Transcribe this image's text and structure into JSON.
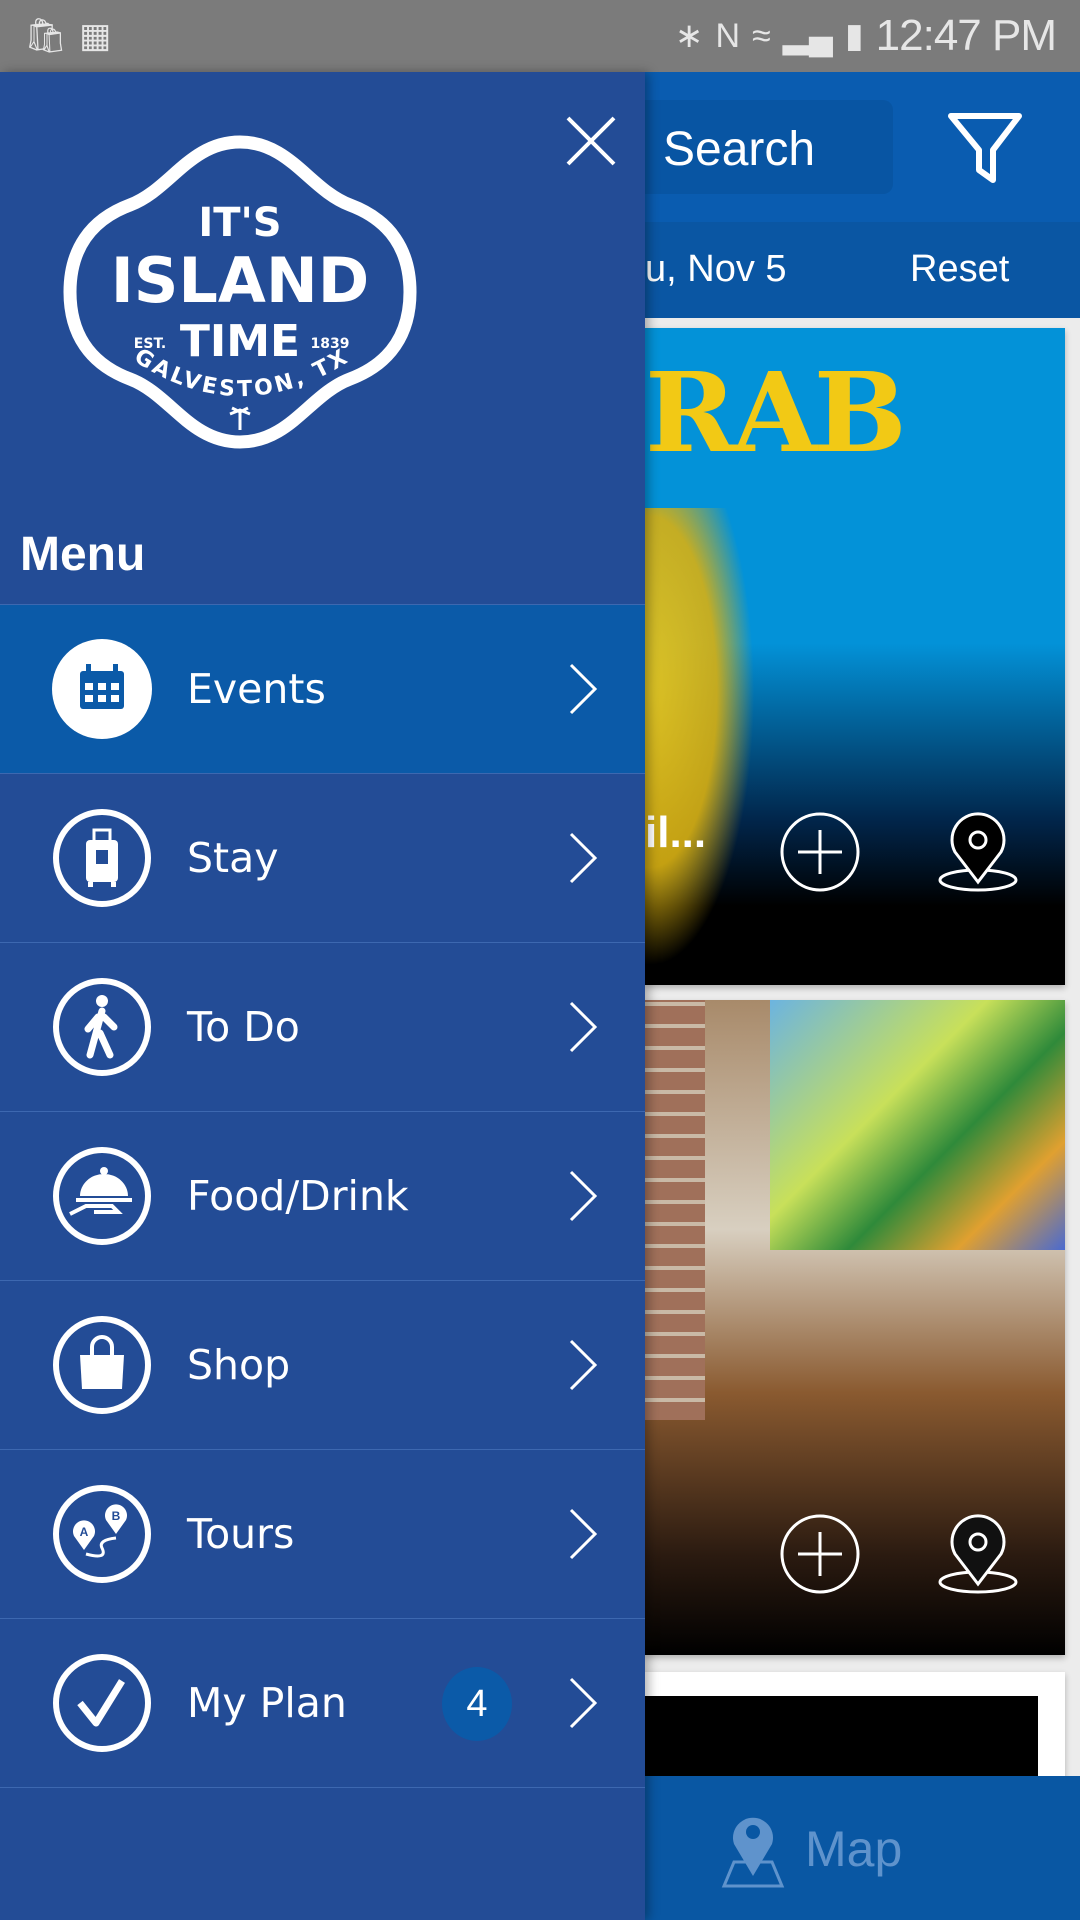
{
  "status_bar": {
    "time": "12:47 PM",
    "icons": [
      "shopping-bag-icon",
      "sim-off-icon",
      "bluetooth-icon",
      "nfc-icon",
      "wifi-icon",
      "signal-icon",
      "battery-charging-icon"
    ]
  },
  "header": {
    "search_label": "Search",
    "filter_icon": "filter-icon"
  },
  "date_bar": {
    "date": "u, Nov 5",
    "reset_label": "Reset"
  },
  "cards": [
    {
      "artwork_text": "RAB",
      "title": "il...",
      "add_icon": "plus-circle-icon",
      "map_icon": "map-pin-icon"
    },
    {
      "add_icon": "plus-circle-icon",
      "map_icon": "map-pin-icon"
    },
    {}
  ],
  "bottom_bar": {
    "map_label": "Map"
  },
  "drawer": {
    "logo": {
      "line1": "IT'S",
      "line2": "ISLAND",
      "line3": "TIME",
      "est": "EST.",
      "year": "1839",
      "place": "GALVESTON, TX"
    },
    "menu_title": "Menu",
    "items": [
      {
        "label": "Events",
        "icon": "calendar-icon",
        "active": true
      },
      {
        "label": "Stay",
        "icon": "luggage-icon"
      },
      {
        "label": "To Do",
        "icon": "walking-person-icon"
      },
      {
        "label": "Food/Drink",
        "icon": "cloche-icon"
      },
      {
        "label": "Shop",
        "icon": "shopping-bag-icon"
      },
      {
        "label": "Tours",
        "icon": "route-icon"
      },
      {
        "label": "My Plan",
        "icon": "checkmark-icon",
        "badge": "4"
      }
    ]
  },
  "colors": {
    "drawer": "#234c96",
    "active": "#0b5aa8",
    "header": "#0a5cb0",
    "status_bar": "#7b7b7b"
  }
}
